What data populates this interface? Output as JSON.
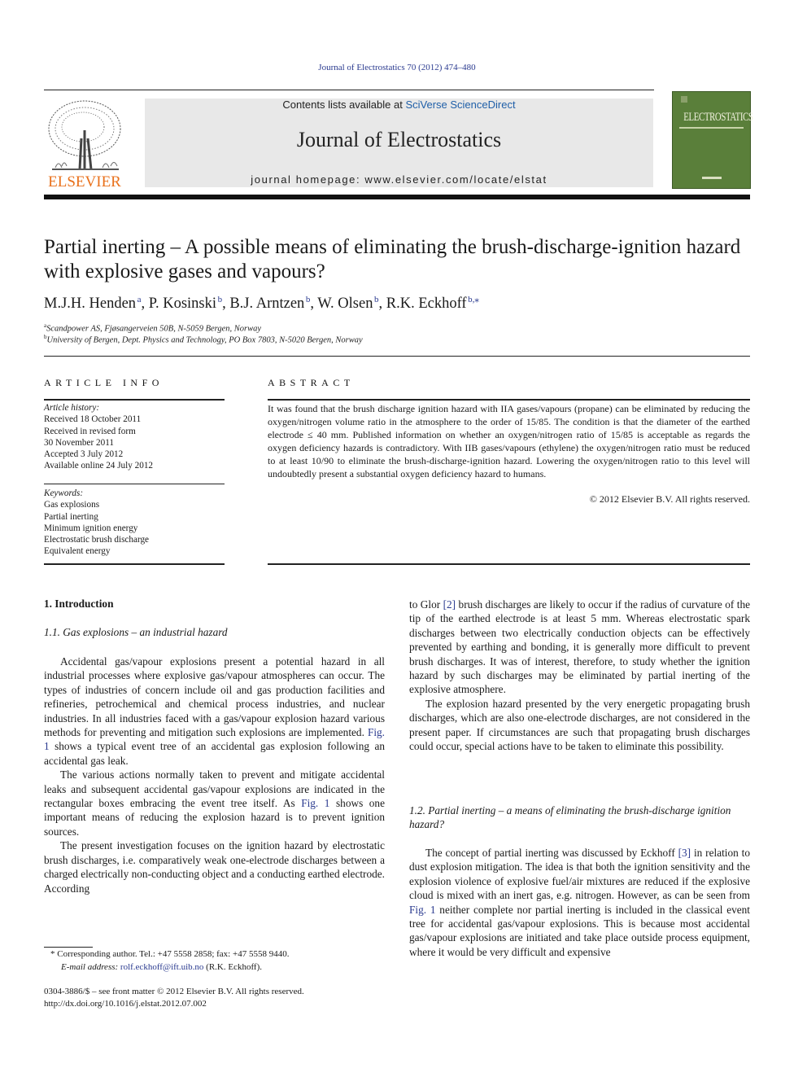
{
  "header": {
    "journal_ref": "Journal of Electrostatics 70 (2012) 474–480",
    "contents_prefix": "Contents lists available at ",
    "contents_link": "SciVerse ScienceDirect",
    "journal_title": "Journal of Electrostatics",
    "homepage_label": "journal homepage: www.elsevier.com/locate/elstat",
    "publisher_logo_text": "ELSEVIER",
    "cover_title": "ELECTROSTATICS",
    "colors": {
      "link": "#2a3a8f",
      "elsevier_orange": "#e9711c",
      "cover_green": "#5a7f3a",
      "banner_gray": "#e8e8e8"
    }
  },
  "article": {
    "title": "Partial inerting – A possible means of eliminating the brush-discharge-ignition hazard with explosive gases and vapours?",
    "authors": [
      {
        "name": "M.J.H. Henden",
        "aff": "a"
      },
      {
        "name": "P. Kosinski",
        "aff": "b"
      },
      {
        "name": "B.J. Arntzen",
        "aff": "b"
      },
      {
        "name": "W. Olsen",
        "aff": "b"
      },
      {
        "name": "R.K. Eckhoff",
        "aff": "b,⁎"
      }
    ],
    "affiliations": [
      {
        "key": "a",
        "text": "Scandpower AS, Fjøsangerveien 50B, N-5059 Bergen, Norway"
      },
      {
        "key": "b",
        "text": "University of Bergen, Dept. Physics and Technology, PO Box 7803, N-5020 Bergen, Norway"
      }
    ]
  },
  "article_info": {
    "heading": "ARTICLE INFO",
    "history_label": "Article history:",
    "history": [
      "Received 18 October 2011",
      "Received in revised form",
      "30 November 2011",
      "Accepted 3 July 2012",
      "Available online 24 July 2012"
    ],
    "keywords_label": "Keywords:",
    "keywords": [
      "Gas explosions",
      "Partial inerting",
      "Minimum ignition energy",
      "Electrostatic brush discharge",
      "Equivalent energy"
    ]
  },
  "abstract": {
    "heading": "ABSTRACT",
    "text": "It was found that the brush discharge ignition hazard with IIA gases/vapours (propane) can be eliminated by reducing the oxygen/nitrogen volume ratio in the atmosphere to the order of 15/85. The condition is that the diameter of the earthed electrode ≤ 40 mm. Published information on whether an oxygen/nitrogen ratio of 15/85 is acceptable as regards the oxygen deficiency hazards is contradictory. With IIB gases/vapours (ethylene) the oxygen/nitrogen ratio must be reduced to at least 10/90 to eliminate the brush-discharge-ignition hazard. Lowering the oxygen/nitrogen ratio to this level will undoubtedly present a substantial oxygen deficiency hazard to humans.",
    "copyright": "© 2012 Elsevier B.V. All rights reserved."
  },
  "body": {
    "section1_heading": "1.  Introduction",
    "section1_1_heading": "1.1.  Gas explosions – an industrial hazard",
    "left_paragraphs": [
      {
        "pre": "Accidental gas/vapour explosions present a potential hazard in all industrial processes where explosive gas/vapour atmospheres can occur. The types of industries of concern include oil and gas production facilities and refineries, petrochemical and chemical process industries, and nuclear industries. In all industries faced with a gas/vapour explosion hazard various methods for preventing and mitigation such explosions are implemented. ",
        "link": "Fig. 1",
        "post": " shows a typical event tree of an accidental gas explosion following an accidental gas leak."
      },
      {
        "pre": "The various actions normally taken to prevent and mitigate accidental leaks and subsequent accidental gas/vapour explosions are indicated in the rectangular boxes embracing the event tree itself. As ",
        "link": "Fig. 1",
        "post": " shows one important means of reducing the explosion hazard is to prevent ignition sources."
      },
      {
        "pre": "The present investigation focuses on the ignition hazard by electrostatic brush discharges, i.e. comparatively weak one-electrode discharges between a charged electrically non-conducting object and a conducting earthed electrode. According",
        "link": "",
        "post": ""
      }
    ],
    "right_paragraphs_top": [
      {
        "pre": "to Glor ",
        "link": "[2]",
        "post": " brush discharges are likely to occur if the radius of curvature of the tip of the earthed electrode is at least 5 mm. Whereas electrostatic spark discharges between two electrically conduction objects can be effectively prevented by earthing and bonding, it is generally more difficult to prevent brush discharges. It was of interest, therefore, to study whether the ignition hazard by such discharges may be eliminated by partial inerting of the explosive atmosphere."
      },
      {
        "pre": "The explosion hazard presented by the very energetic propagating brush discharges, which are also one-electrode discharges, are not considered in the present paper. If circumstances are such that propagating brush discharges could occur, special actions have to be taken to eliminate this possibility.",
        "link": "",
        "post": ""
      }
    ],
    "section1_2_heading": "1.2.  Partial inerting – a means of eliminating the brush-discharge ignition hazard?",
    "right_paragraphs_bottom": [
      {
        "pre": "The concept of partial inerting was discussed by Eckhoff ",
        "link": "[3]",
        "post": " in relation to dust explosion mitigation. The idea is that both the ignition sensitivity and the explosion violence of explosive fuel/air mixtures are reduced if the explosive cloud is mixed with an inert gas, e.g. nitrogen. However, as can be seen from "
      },
      {
        "pre": "",
        "link": "Fig. 1",
        "post": " neither complete nor partial inerting is included in the classical event tree for accidental gas/vapour explosions. This is because most accidental gas/vapour explosions are initiated and take place outside process equipment, where it would be very difficult and expensive"
      }
    ]
  },
  "footnotes": {
    "corresponding": "*  Corresponding author. Tel.: +47 5558 2858; fax: +47 5558 9440.",
    "email_label": "E-mail address: ",
    "email": "rolf.eckhoff@ift.uib.no",
    "email_suffix": " (R.K. Eckhoff).",
    "front_matter": "0304-3886/$ – see front matter © 2012 Elsevier B.V. All rights reserved.",
    "doi": "http://dx.doi.org/10.1016/j.elstat.2012.07.002"
  }
}
